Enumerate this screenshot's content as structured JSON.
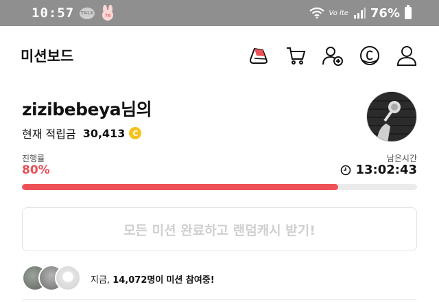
{
  "status_bar": {
    "time": "10:57",
    "talk_badge": "TALK",
    "volte": "Vo lte",
    "battery": "76%"
  },
  "header": {
    "title": "미션보드",
    "icons": [
      "mission-shoe-icon",
      "cart-icon",
      "add-friend-icon",
      "coin-c-icon",
      "user-profile-icon"
    ]
  },
  "profile": {
    "username": "zizibebeya님의",
    "points_label": "현재 적립금",
    "points_value": "30,413",
    "coin_symbol": "C"
  },
  "progress": {
    "label": "진행률",
    "value_text": "80%",
    "fraction": 0.8,
    "remaining_label": "남은시간",
    "remaining_time": "13:02:43"
  },
  "action": {
    "random_cash_label": "모든 미션 완료하고 랜덤캐시 받기!"
  },
  "participants": {
    "prefix": "지금,",
    "count_text": "14,072명이",
    "suffix": "미션 참여중!"
  },
  "colors": {
    "accent": "#ef5158",
    "coin": "#f4c21e",
    "status_bar": "#8f8f8f"
  }
}
